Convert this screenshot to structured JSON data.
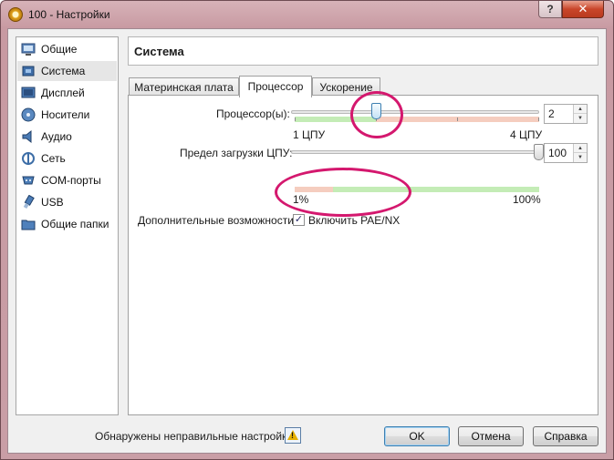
{
  "window": {
    "title": "100 - Настройки",
    "help_label": "?",
    "close_label": "✕"
  },
  "sidebar": {
    "items": [
      {
        "label": "Общие",
        "icon": "monitor-icon"
      },
      {
        "label": "Система",
        "icon": "chip-icon"
      },
      {
        "label": "Дисплей",
        "icon": "display-icon"
      },
      {
        "label": "Носители",
        "icon": "storage-icon"
      },
      {
        "label": "Аудио",
        "icon": "speaker-icon"
      },
      {
        "label": "Сеть",
        "icon": "network-icon"
      },
      {
        "label": "COM-порты",
        "icon": "serial-port-icon"
      },
      {
        "label": "USB",
        "icon": "usb-icon"
      },
      {
        "label": "Общие папки",
        "icon": "folder-icon"
      }
    ],
    "selected": "Система"
  },
  "page": {
    "title": "Система"
  },
  "tabs": [
    {
      "label": "Материнская плата",
      "active": false
    },
    {
      "label": "Процессор",
      "active": true
    },
    {
      "label": "Ускорение",
      "active": false
    }
  ],
  "processor": {
    "cpu_label": "Процессор(ы):",
    "cpu_min_label": "1 ЦПУ",
    "cpu_max_label": "4 ЦПУ",
    "cpu_value": "2",
    "cpu_slider": {
      "min": 1,
      "max": 4,
      "value": 2
    },
    "cap_label": "Предел загрузки ЦПУ:",
    "cap_min_label": "1%",
    "cap_max_label": "100%",
    "cap_value": "100",
    "cap_slider": {
      "min": 1,
      "max": 100,
      "value": 100
    },
    "extended_label": "Дополнительные возможности:",
    "pae_label": "Включить PAE/NX",
    "pae_checked": true
  },
  "footer": {
    "status_text": "Обнаружены неправильные настройки",
    "warning_icon": "warning-icon",
    "ok_label": "OK",
    "cancel_label": "Отмена",
    "help_label": "Справка"
  },
  "colors": {
    "annotation": "#d4186e",
    "safe_zone": "#c4ecb6",
    "warn_zone": "#f5cdbf",
    "title_bar": "#c99ea6"
  }
}
